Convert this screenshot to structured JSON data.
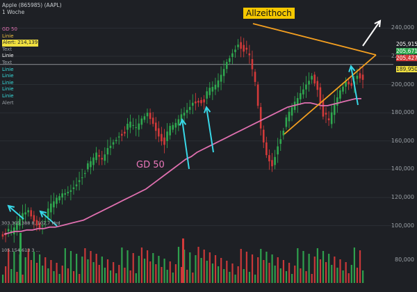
{
  "header": {
    "title": "Apple (865985) (AAPL)",
    "period": "1 Woche"
  },
  "indicator_legend": [
    {
      "text": "GD 50",
      "color": "#e070b0"
    },
    {
      "text": "Linie",
      "color": "#f0c040"
    },
    {
      "text": "Alert: 214,139",
      "color": "#1e2025",
      "bg": "#f0e040"
    },
    {
      "text": "Text",
      "color": "#9aa0a6"
    },
    {
      "text": "Linie",
      "color": "#ffffff"
    },
    {
      "text": "Text",
      "color": "#9aa0a6"
    },
    {
      "text": "Linie",
      "color": "#38e0e0"
    },
    {
      "text": "Linie",
      "color": "#38e0e0"
    },
    {
      "text": "Linie",
      "color": "#38e0e0"
    },
    {
      "text": "Linie",
      "color": "#38e0e0"
    },
    {
      "text": "Linie",
      "color": "#38e0e0"
    },
    {
      "text": "Alert",
      "color": "#9aa0a6"
    }
  ],
  "price_axis": {
    "ticks": [
      "240,000",
      "220,000",
      "200,000",
      "180,000",
      "160,000",
      "140,000",
      "120,000",
      "100,000"
    ],
    "volume_tick": "80,000"
  },
  "price_tags": [
    {
      "text": "205,915",
      "bg": "#1e2025",
      "color": "#ffffff",
      "value": 205.915
    },
    {
      "text": "205,671",
      "bg": "#2fa84f",
      "color": "#ffffff",
      "value": 205.671
    },
    {
      "text": "205,427",
      "bg": "#d33a3a",
      "color": "#ffffff",
      "value": 205.427
    },
    {
      "text": "189,950",
      "bg": "#f0e040",
      "color": "#1e2025",
      "value": 189.95
    }
  ],
  "annotations": {
    "ath_label": "Allzeithoch",
    "ma_label": "GD 50",
    "low_value_text": "303.305.388 8, 102,7 Mrd",
    "volume_text": "105.154.613 3 ..."
  },
  "colors": {
    "background": "#1e2025",
    "up": "#2fa84f",
    "down": "#d33a3a",
    "ma": "#e070b0",
    "triangle": "#f5a020",
    "arrow_cyan": "#38d8e8",
    "arrow_white": "#ffffff",
    "grid": "#33373d"
  },
  "chart_data": {
    "type": "candlestick",
    "title": "Apple (865985) (AAPL)",
    "ylim": [
      90,
      250
    ],
    "price_ticks": [
      100,
      120,
      140,
      160,
      180,
      200,
      220,
      240
    ],
    "alert_level": 214.139,
    "last_price": 205.671,
    "moving_average": {
      "name": "GD 50",
      "values": [
        94,
        95,
        96,
        96,
        97,
        97,
        98,
        98,
        99,
        99,
        100,
        101,
        102,
        103,
        104,
        106,
        108,
        110,
        112,
        114,
        116,
        118,
        120,
        122,
        124,
        126,
        129,
        132,
        135,
        138,
        141,
        144,
        147,
        149,
        152,
        154,
        156,
        158,
        160,
        162,
        164,
        166,
        168,
        170,
        172,
        174,
        176,
        178,
        180,
        182,
        184,
        185,
        186,
        187,
        187,
        186,
        185,
        185,
        186,
        187,
        188,
        189,
        190,
        190
      ]
    },
    "close": [
      96,
      94,
      100,
      108,
      111,
      104,
      100,
      106,
      113,
      118,
      122,
      124,
      128,
      134,
      140,
      143,
      150,
      146,
      155,
      160,
      165,
      168,
      171,
      168,
      175,
      180,
      173,
      165,
      160,
      168,
      171,
      178,
      182,
      188,
      189,
      190,
      195,
      198,
      206,
      216,
      223,
      230,
      226,
      218,
      200,
      168,
      150,
      143,
      158,
      170,
      178,
      186,
      193,
      200,
      207,
      198,
      180,
      172,
      185,
      195,
      202,
      200,
      208,
      206
    ]
  }
}
